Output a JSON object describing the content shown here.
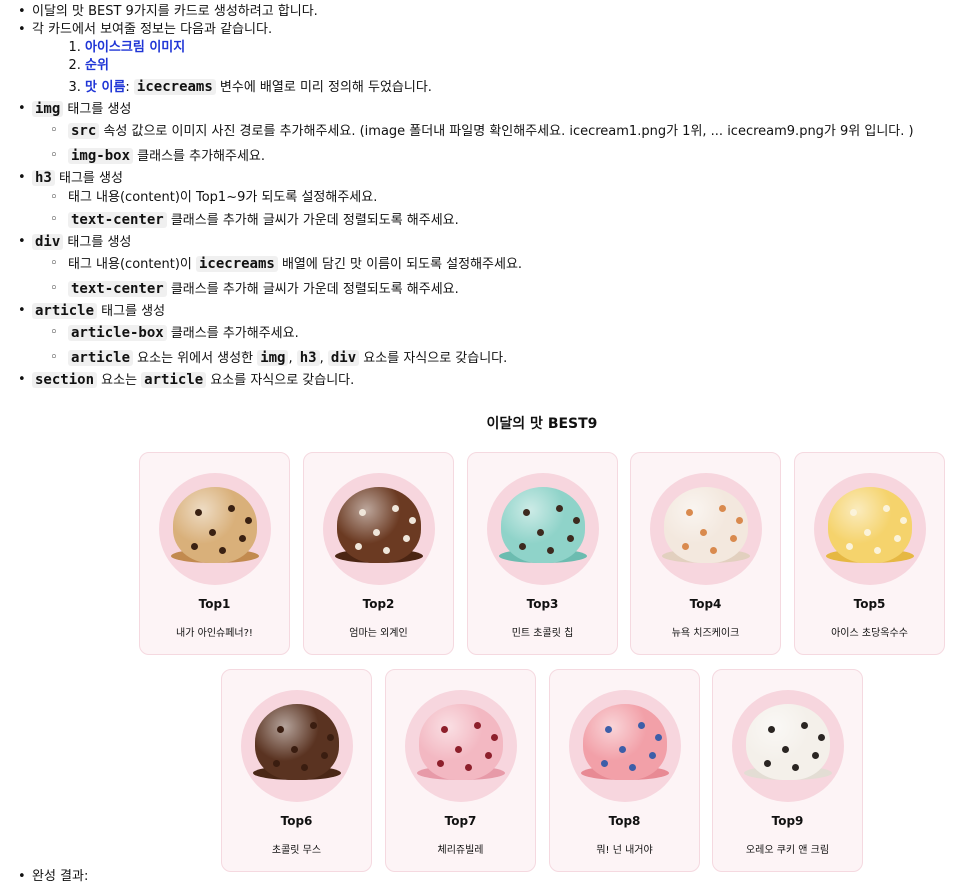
{
  "instructions": {
    "intro": "이달의 맛 BEST 9가지를 카드로 생성하려고 합니다.",
    "card_info": "각 카드에서 보여줄 정보는 다음과 같습니다.",
    "card_items": [
      {
        "label": "아이스크림 이미지"
      },
      {
        "label": "순위"
      },
      {
        "label": "맛 이름",
        "colon": ": ",
        "code": "icecreams",
        "rest": " 변수에 배열로 미리 정의해 두었습니다."
      }
    ],
    "img": {
      "tag": "img",
      "label": " 태그를 생성",
      "src_code": "src",
      "src_text": " 속성 값으로 이미지 사진 경로를 추가해주세요. (image 폴더내 파일명 확인해주세요. icecream1.png가 1위, ... icecream9.png가 9위 입니다. )",
      "class_code": "img-box",
      "class_text": " 클래스를 추가해주세요."
    },
    "h3": {
      "tag": "h3",
      "label": " 태그를 생성",
      "content_text": "태그 내용(content)이 Top1~9가 되도록 설정해주세요.",
      "class_code": "text-center",
      "class_text": " 클래스를 추가해 글씨가 가운데 정렬되도록 해주세요."
    },
    "div": {
      "tag": "div",
      "label": " 태그를 생성",
      "content_pre": "태그 내용(content)이 ",
      "content_code": "icecreams",
      "content_post": " 배열에 담긴 맛 이름이 되도록 설정해주세요.",
      "class_code": "text-center",
      "class_text": " 클래스를 추가해 글씨가 가운데 정렬되도록 해주세요."
    },
    "article": {
      "tag": "article",
      "label": " 태그를 생성",
      "class_code": "article-box",
      "class_text": " 클래스를 추가해주세요.",
      "child_code": "article",
      "child_mid": " 요소는 위에서 생성한 ",
      "c1": "img",
      "sep": ", ",
      "c2": "h3",
      "c3": "div",
      "child_end": " 요소를 자식으로 갖습니다."
    },
    "section": {
      "code": "section",
      "mid": " 요소는 ",
      "code2": "article",
      "end": " 요소를 자식으로 갖습니다."
    }
  },
  "heading": "이달의 맛 BEST9",
  "cards": [
    {
      "rank": "Top1",
      "name": "내가 아인슈페너?!",
      "color": "#d9b07a",
      "chip": "#3a2112",
      "base": "#c28a4f"
    },
    {
      "rank": "Top2",
      "name": "엄마는 외계인",
      "color": "#6b3a22",
      "chip": "#efe6da",
      "base": "#4b2513"
    },
    {
      "rank": "Top3",
      "name": "민트 초콜릿 칩",
      "color": "#8fd3c9",
      "chip": "#3d2a1f",
      "base": "#6cbcb0"
    },
    {
      "rank": "Top4",
      "name": "뉴욕 치즈케이크",
      "color": "#f3e8de",
      "chip": "#d98a4e",
      "base": "#e2d0bf"
    },
    {
      "rank": "Top5",
      "name": "아이스 초당옥수수",
      "color": "#f5d36c",
      "chip": "#fbf3da",
      "base": "#e6b843"
    },
    {
      "rank": "Top6",
      "name": "초콜릿 무스",
      "color": "#5a3321",
      "chip": "#3a1d10",
      "base": "#4a2716"
    },
    {
      "rank": "Top7",
      "name": "체리쥬빌레",
      "color": "#f3b8c2",
      "chip": "#8d1f2b",
      "base": "#e79aa8"
    },
    {
      "rank": "Top8",
      "name": "뭐! 넌 내거야",
      "color": "#f2a0a8",
      "chip": "#3d5ea8",
      "base": "#e88a94"
    },
    {
      "rank": "Top9",
      "name": "오레오 쿠키 앤 크림",
      "color": "#f4f0ea",
      "chip": "#2a2522",
      "base": "#e3ddd4"
    }
  ],
  "result_label": "완성 결과:"
}
